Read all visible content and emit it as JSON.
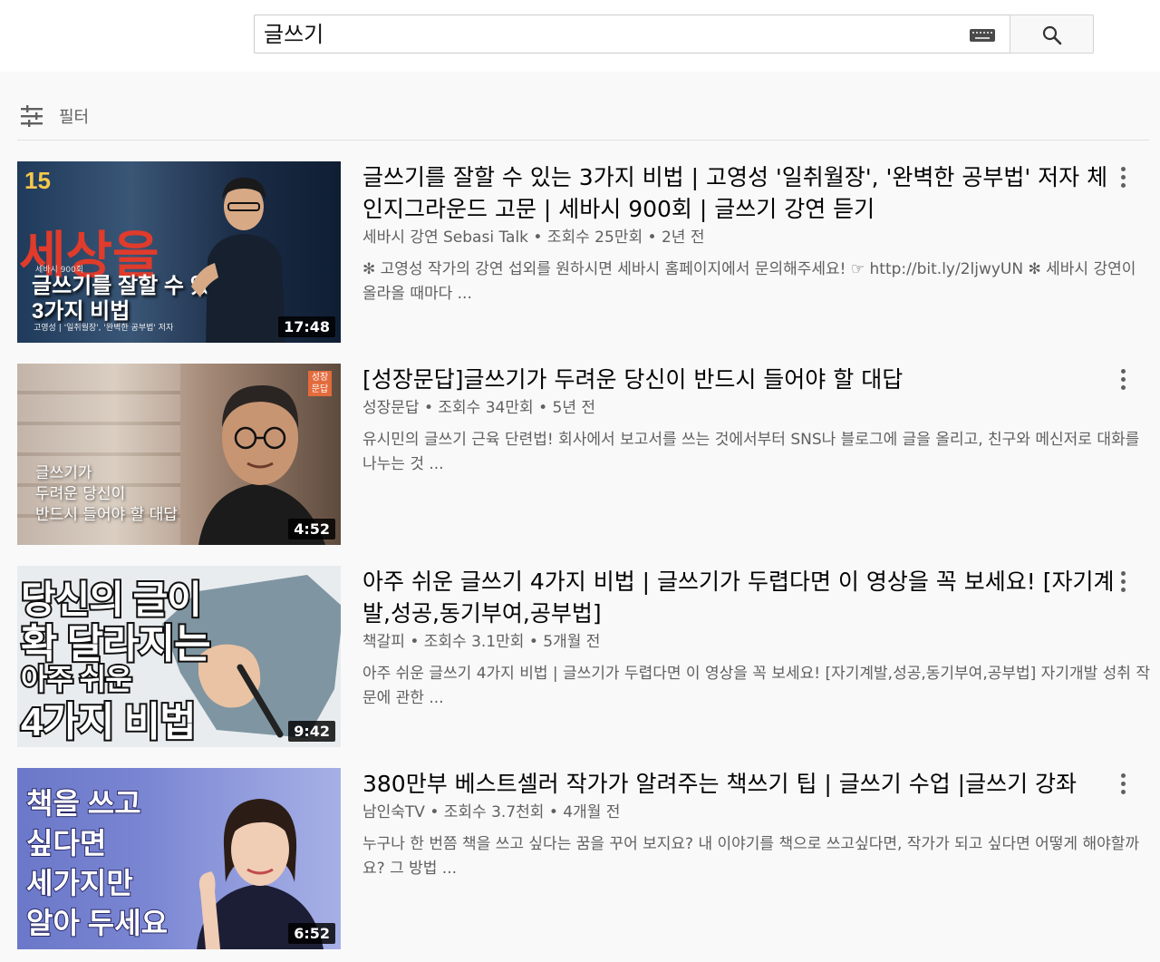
{
  "search": {
    "query": "글쓰기"
  },
  "filter": {
    "label": "필터"
  },
  "results": [
    {
      "title": "글쓰기를 잘할 수 있는 3가지 비법 | 고영성 '일취월장', '완벽한 공부법' 저자 체인지그라운드 고문 | 세바시 900회 | 글쓰기 강연 듣기",
      "channel": "세바시 강연 Sebasi Talk",
      "views": "조회수 25만회",
      "age": "2년 전",
      "description": "✻ 고영성 작가의 강연 섭외를 원하시면 세바시 홈페이지에서 문의해주세요! ☞ http://bit.ly/2ljwyUN ✻ 세바시 강연이 올라올 때마다 ...",
      "duration": "17:48",
      "thumb": {
        "brand": "15",
        "big_red": "세상을",
        "small": "세바시 900회",
        "caption": "글쓰기를 잘할 수 있는\n3가지 비법",
        "author": "고영성 | '일취월장', '완벽한 공부법' 저자"
      }
    },
    {
      "title": "[성장문답]글쓰기가 두려운 당신이 반드시 들어야 할 대답",
      "channel": "성장문답",
      "views": "조회수 34만회",
      "age": "5년 전",
      "description": "유시민의 글쓰기 근육 단련법! 회사에서 보고서를 쓰는 것에서부터 SNS나 블로그에 글을 올리고, 친구와 메신저로 대화를 나누는 것 ...",
      "duration": "4:52",
      "thumb": {
        "badge": "성장\n문답",
        "caption": "글쓰기가\n두려운 당신이\n반드시 들어야 할 대답"
      }
    },
    {
      "title": "아주 쉬운 글쓰기 4가지 비법 | 글쓰기가 두렵다면 이 영상을 꼭 보세요! [자기계발,성공,동기부여,공부법]",
      "channel": "책갈피",
      "views": "조회수 3.1만회",
      "age": "5개월 전",
      "description": "아주 쉬운 글쓰기 4가지 비법 | 글쓰기가 두렵다면 이 영상을 꼭 보세요! [자기계발,성공,동기부여,공부법] 자기개발 성취 작문에 관한 ...",
      "duration": "9:42",
      "thumb": {
        "line1": "당신의 글이",
        "line2": "확 달라지는",
        "line3": "아주 쉬운",
        "line4": "4가지 비법"
      }
    },
    {
      "title": "380만부 베스트셀러 작가가 알려주는 책쓰기 팁 | 글쓰기 수업 |글쓰기 강좌",
      "channel": "남인숙TV",
      "views": "조회수 3.7천회",
      "age": "4개월 전",
      "description": "누구나 한 번쯤 책을 쓰고 싶다는 꿈을 꾸어 보지요? 내 이야기를 책으로 쓰고싶다면, 작가가 되고 싶다면 어떻게 해야할까요? 그 방법 ...",
      "duration": "6:52",
      "thumb": {
        "line1": "책을 쓰고",
        "line2": "싶다면",
        "line3": "세가지만",
        "line4": "알아 두세요"
      }
    }
  ],
  "separator": "•"
}
